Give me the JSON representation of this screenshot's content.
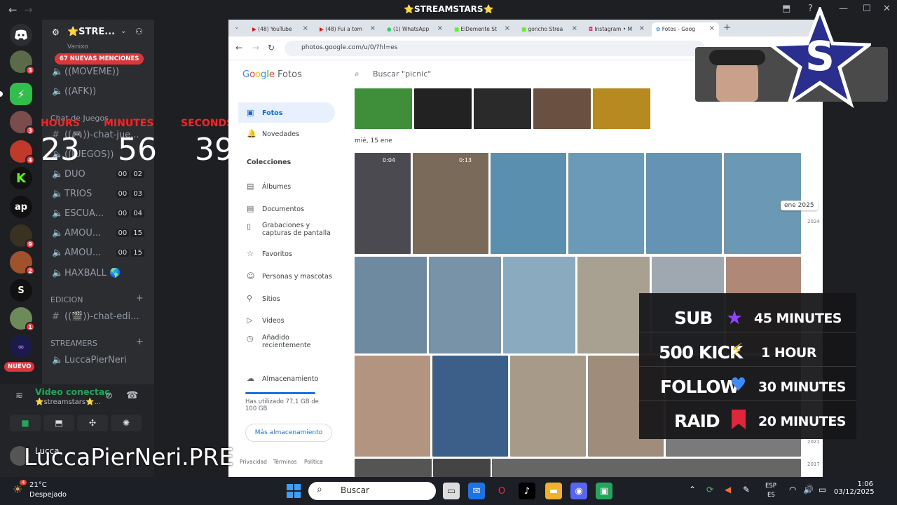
{
  "window": {
    "title": "⭐STREAMSTARS⭐",
    "back": "←",
    "forward": "→",
    "controls": [
      "⬇",
      "?",
      "—",
      "☐",
      "✕"
    ]
  },
  "servers": [
    {
      "label": "",
      "badge": "3"
    },
    {
      "label": "",
      "badge": ""
    },
    {
      "label": "",
      "badge": "3"
    },
    {
      "label": "",
      "badge": "4"
    },
    {
      "label": "K",
      "badge": ""
    },
    {
      "label": "ap",
      "badge": ""
    },
    {
      "label": "",
      "badge": "9"
    },
    {
      "label": "",
      "badge": "2"
    },
    {
      "label": "S",
      "badge": ""
    },
    {
      "label": "",
      "badge": "1"
    },
    {
      "label": "",
      "badge": ""
    },
    {
      "label": "NUEVO",
      "badge": ""
    }
  ],
  "sidebar": {
    "server_name": "⭐STRE...",
    "mentions": "67 NUEVAS MENCIONES",
    "partial_top": "Vanixo",
    "voice_channels_top": [
      "((MOVEME))",
      "((AFK))"
    ],
    "category_games": "Chat de Juegos",
    "text_games": "((🎮))-chat-jue...",
    "games_voice": "((JUEGOS))",
    "channels": [
      {
        "name": "DUO",
        "a": "00",
        "b": "02"
      },
      {
        "name": "TRIOS",
        "a": "00",
        "b": "03"
      },
      {
        "name": "ESCUA...",
        "a": "00",
        "b": "04"
      },
      {
        "name": "AMOU...",
        "a": "00",
        "b": "15"
      },
      {
        "name": "AMOU...",
        "a": "00",
        "b": "15"
      }
    ],
    "haxball": "HAXBALL 🌎",
    "category_edition": "EDICION",
    "text_edition": "((🎬))-chat-edi...",
    "category_streamers": "STREAMERS",
    "streamer_voice": "LuccaPierNeri",
    "plus": "+"
  },
  "timer": {
    "hours_label": "HOURS",
    "minutes_label": "MINUTES",
    "seconds_label": "SECONDS",
    "hours": "23",
    "minutes": "56",
    "seconds": "39"
  },
  "voice_panel": {
    "status": "Video conectac",
    "server": "⭐streamstars⭐...",
    "user": "Lucca"
  },
  "browser": {
    "tabs": [
      "(48) YouTube",
      "(48) Fui a tom",
      "(1) WhatsApp",
      "ElDemente St",
      "goncho Strea",
      "Instagram • M",
      "Fotos - Goog"
    ],
    "new_tab": "+",
    "url": "photos.google.com/u/0/?hl=es"
  },
  "google_photos": {
    "logo_g": "Google",
    "logo_f": "Fotos",
    "search_placeholder": "Buscar \"picnic\"",
    "nav_fotos": "Fotos",
    "nav_novedades": "Novedades",
    "section_colecciones": "Colecciones",
    "nav_albumes": "Álbumes",
    "nav_documentos": "Documentos",
    "nav_grabaciones": "Grabaciones y capturas de pantalla",
    "nav_favoritos": "Favoritos",
    "nav_personas": "Personas y mascotas",
    "nav_sitios": "Sitios",
    "nav_videos": "Videos",
    "nav_anadido": "Añadido recientemente",
    "storage_title": "Almacenamiento",
    "storage_used": "Has utilizado 77,1 GB de 100 GB",
    "more_storage": "Más almacenamiento",
    "footer": [
      "Privacidad",
      "Términos",
      "Política"
    ],
    "date_header": "mié, 15 ene",
    "scrubber_label": "ene 2025",
    "year_2024": "2024",
    "year_2021": "2021",
    "year_2017": "2017",
    "video_durations": [
      "0:04",
      "0:13"
    ]
  },
  "goals": [
    {
      "label": "SUB",
      "icon": "★",
      "value": "45 MINUTES",
      "color": "#8e44ff"
    },
    {
      "label": "500 KICK",
      "icon": "⚡",
      "value": "1 HOUR",
      "color": "#ffcc00"
    },
    {
      "label": "FOLLOW",
      "icon": "♥",
      "value": "30 MINUTES",
      "color": "#3d8bff"
    },
    {
      "label": "RAID",
      "icon": "🔖",
      "value": "20 MINUTES",
      "color": "#e0263a"
    }
  ],
  "stream_name": "LuccaPierNeri.PRE",
  "taskbar": {
    "weather_temp": "21°C",
    "weather_desc": "Despejado",
    "weather_badge": "4",
    "search": "Buscar",
    "lang": "ESP",
    "lang2": "ES",
    "time": "1:06",
    "date": "03/12/2025"
  }
}
